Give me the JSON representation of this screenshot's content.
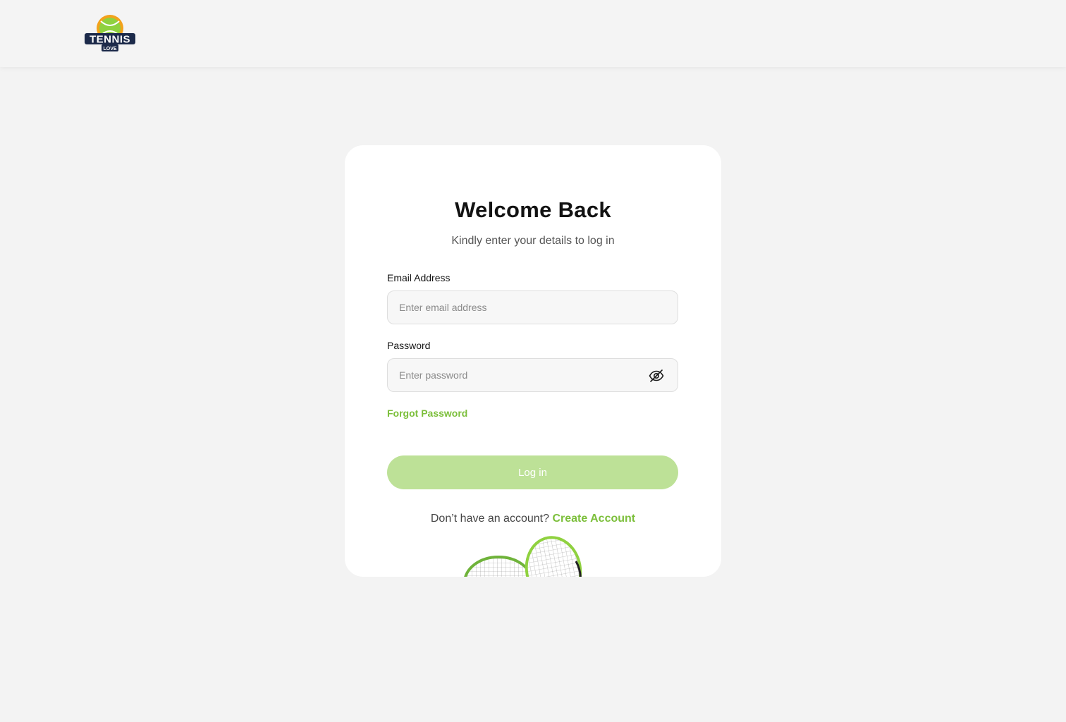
{
  "brand": {
    "logo_text": "TENNIS",
    "logo_subtext": "LOVE",
    "colors": {
      "primary_green": "#7cbf3b",
      "button_disabled": "#bde197",
      "logo_navy": "#1c2a4a",
      "logo_orange": "#f2a21b"
    }
  },
  "login": {
    "title": "Welcome Back",
    "subtitle": "Kindly enter your details to log in",
    "email_label": "Email Address",
    "email_placeholder": "Enter email address",
    "password_label": "Password",
    "password_placeholder": "Enter password",
    "password_toggle_icon": "eye-off-icon",
    "forgot_label": "Forgot Password",
    "submit_label": "Log in",
    "signup_prompt": "Don’t have an account?",
    "signup_link": "Create Account"
  },
  "illustration": {
    "icon": "tennis-rackets-illustration"
  }
}
